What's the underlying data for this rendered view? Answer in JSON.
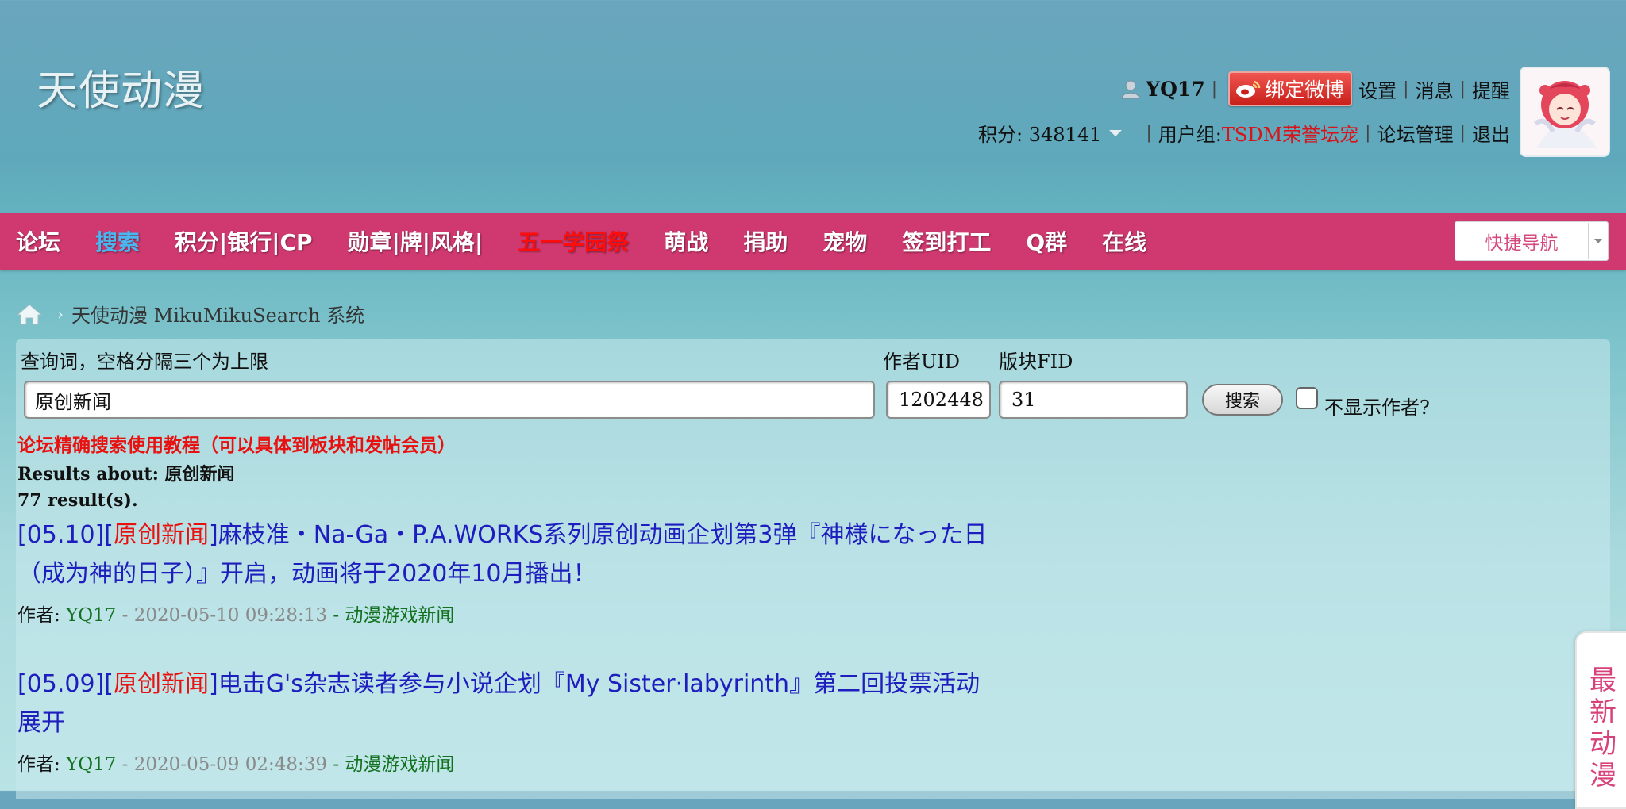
{
  "site": {
    "logo_text": "天使动漫"
  },
  "user": {
    "username": "YQ17",
    "weibo_button": "绑定微博",
    "links": [
      "设置",
      "消息",
      "提醒"
    ],
    "credits_label": "积分: 348141",
    "usergroup_label": "用户组: ",
    "usergroup_value": "TSDM荣誉坛宠",
    "admin_link": "论坛管理",
    "logout_link": "退出"
  },
  "nav": {
    "items": [
      "论坛",
      "搜索",
      "积分|银行|CP",
      "勋章|牌|风格|",
      "五一学园祭",
      "萌战",
      "捐助",
      "宠物",
      "签到打工",
      "Q群",
      "在线"
    ],
    "quicknav": "快捷导航"
  },
  "breadcrumb": {
    "current": "天使动漫 MikuMikuSearch 系统"
  },
  "search": {
    "query_label": "查询词，空格分隔三个为上限",
    "query_value": "原创新闻",
    "uid_label": "作者UID",
    "uid_value": "1202448",
    "fid_label": "版块FID",
    "fid_value": "31",
    "button": "搜索",
    "hide_author_label": "不显示作者?"
  },
  "tutorial_link": "论坛精确搜索使用教程（可以具体到板块和发帖会员）",
  "results": {
    "about_label": "Results about: ",
    "about_value": "原创新闻",
    "count": "77 result(s).",
    "items": [
      {
        "prefix": "[05.10][",
        "tag": "原创新闻",
        "title": "]麻枝准・Na-Ga・P.A.WORKS系列原创动画企划第3弹『神様になった日（成为神的日子）』开启，动画将于2020年10月播出！",
        "author_label": "作者: ",
        "author": "YQ17",
        "date": " - 2020-05-10 09:28:13 ",
        "forum": "- 动漫游戏新闻"
      },
      {
        "prefix": "[05.09][",
        "tag": "原创新闻",
        "title": "]电击G's杂志读者参与小说企划『My Sister·labyrinth』第二回投票活动展开",
        "author_label": "作者: ",
        "author": "YQ17",
        "date": " - 2020-05-09 02:48:39 ",
        "forum": "- 动漫游戏新闻"
      }
    ]
  },
  "side_tab": "最新动漫"
}
